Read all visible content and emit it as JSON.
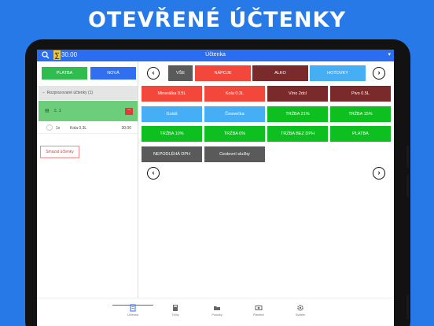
{
  "headline": "OTEVŘENÉ ÚČTENKY",
  "topbar": {
    "amount": "30.00",
    "sigma": "∑",
    "title": "Účtenka",
    "menu": "▾"
  },
  "left": {
    "platba_label": "PLATBA",
    "nova_label": "NOVÁ",
    "group_title": "Rozpracované účtenky (1)",
    "group_toggle": "−",
    "receipt": {
      "name": "č. 1",
      "minus": "−"
    },
    "item": {
      "qty": "1x",
      "name": "Kola 0.3L",
      "price": "30.00"
    },
    "delete_label": "Smazat účtenky"
  },
  "categories": [
    {
      "label": "VŠE",
      "color": "#5a5a5a"
    },
    {
      "label": "NÁPOJE",
      "color": "#f2473a"
    },
    {
      "label": "ALKO",
      "color": "#7a2a2a"
    },
    {
      "label": "HOTOVKY",
      "color": "#45aef5"
    }
  ],
  "products": [
    {
      "label": "Minerálka 0.5L",
      "color": "#f2473a"
    },
    {
      "label": "Kola 0.3L",
      "color": "#f2473a"
    },
    {
      "label": "Víno 2dcl",
      "color": "#7a2a2a"
    },
    {
      "label": "Pivo 0.5L",
      "color": "#7a2a2a"
    },
    {
      "label": "Guláš",
      "color": "#45aef5"
    },
    {
      "label": "Česnečka",
      "color": "#45aef5"
    },
    {
      "label": "TRŽBA 21%",
      "color": "#0ec01f"
    },
    {
      "label": "TRŽBA 15%",
      "color": "#0ec01f"
    },
    {
      "label": "TRŽBA 10%",
      "color": "#0ec01f"
    },
    {
      "label": "TRŽBA 0%",
      "color": "#0ec01f"
    },
    {
      "label": "TRŽBA BEZ DPH",
      "color": "#0ec01f"
    },
    {
      "label": "PLATBA",
      "color": "#0ec01f"
    },
    {
      "label": "NEPODLÉHÁ DPH",
      "color": "#5a5a5a"
    },
    {
      "label": "Cestovní služby",
      "color": "#5a5a5a"
    }
  ],
  "nav": [
    {
      "label": "Účtenka",
      "icon": "receipt-icon"
    },
    {
      "label": "Tržby",
      "icon": "calculator-icon"
    },
    {
      "label": "Položky",
      "icon": "folder-icon"
    },
    {
      "label": "Platební",
      "icon": "banknote-icon"
    },
    {
      "label": "Systém",
      "icon": "gear-icon"
    }
  ]
}
